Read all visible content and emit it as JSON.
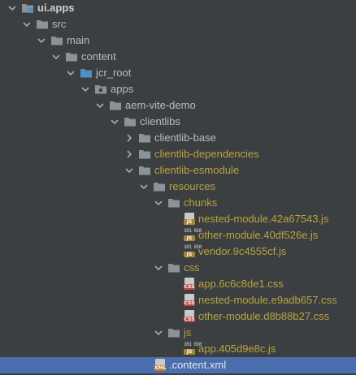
{
  "tree": {
    "rows": [
      {
        "label": "ui.apps",
        "bold": true
      },
      {
        "label": "src"
      },
      {
        "label": "main"
      },
      {
        "label": "content"
      },
      {
        "label": "jcr_root"
      },
      {
        "label": "apps"
      },
      {
        "label": "aem-vite-demo"
      },
      {
        "label": "clientlibs"
      },
      {
        "label": "clientlib-base"
      },
      {
        "label": "clientlib-dependencies"
      },
      {
        "label": "clientlib-esmodule"
      },
      {
        "label": "resources"
      },
      {
        "label": "chunks"
      },
      {
        "label": "nested-module.42a67543.js"
      },
      {
        "label": "other-module.40df526e.js"
      },
      {
        "label": "vendor.9c4555cf.js"
      },
      {
        "label": "css"
      },
      {
        "label": "app.6c6c8de1.css"
      },
      {
        "label": "nested-module.e9adb657.css"
      },
      {
        "label": "other-module.d8b88b27.css"
      },
      {
        "label": "js"
      },
      {
        "label": "app.405d9e8c.js"
      },
      {
        "label": ".content.xml"
      }
    ],
    "badges": {
      "js": "JS",
      "css": "CSS",
      "xml": "XML",
      "binary": "101 010"
    }
  },
  "colors": {
    "background": "#3c3f41",
    "text": "#bbbbbb",
    "excluded_text": "#b8a33f",
    "selection": "#4b6eaf",
    "folder": "#8b9299",
    "source_folder": "#4f8fc4"
  }
}
